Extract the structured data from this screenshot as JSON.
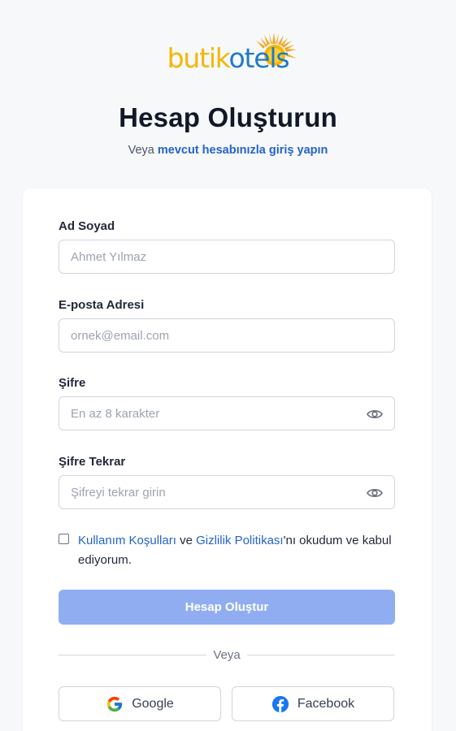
{
  "logo": {
    "part1": "butik",
    "part2": "otels"
  },
  "header": {
    "title": "Hesap Oluşturun",
    "subtitle_prefix": "Veya",
    "login_link": "mevcut hesabınızla giriş yapın"
  },
  "form": {
    "name": {
      "label": "Ad Soyad",
      "placeholder": "Ahmet Yılmaz",
      "value": ""
    },
    "email": {
      "label": "E-posta Adresi",
      "placeholder": "ornek@email.com",
      "value": ""
    },
    "password": {
      "label": "Şifre",
      "placeholder": "En az 8 karakter",
      "value": ""
    },
    "password_confirm": {
      "label": "Şifre Tekrar",
      "placeholder": "Şifreyi tekrar girin",
      "value": ""
    },
    "terms": {
      "checked": false,
      "terms_link": "Kullanım Koşulları",
      "and": "ve",
      "privacy_link": "Gizlilik Politikası",
      "suffix": "'nı okudum ve kabul ediyorum."
    },
    "submit_label": "Hesap Oluştur"
  },
  "divider_label": "Veya",
  "social": {
    "google_label": "Google",
    "facebook_label": "Facebook"
  },
  "icons": {
    "password_toggle": "eye-icon",
    "google": "google-icon",
    "facebook": "facebook-icon"
  },
  "colors": {
    "accent": "#2563c9",
    "button_disabled": "#91adf2",
    "logo_yellow": "#f2b705",
    "logo_blue": "#1f7ac8",
    "facebook_blue": "#1877f2"
  }
}
